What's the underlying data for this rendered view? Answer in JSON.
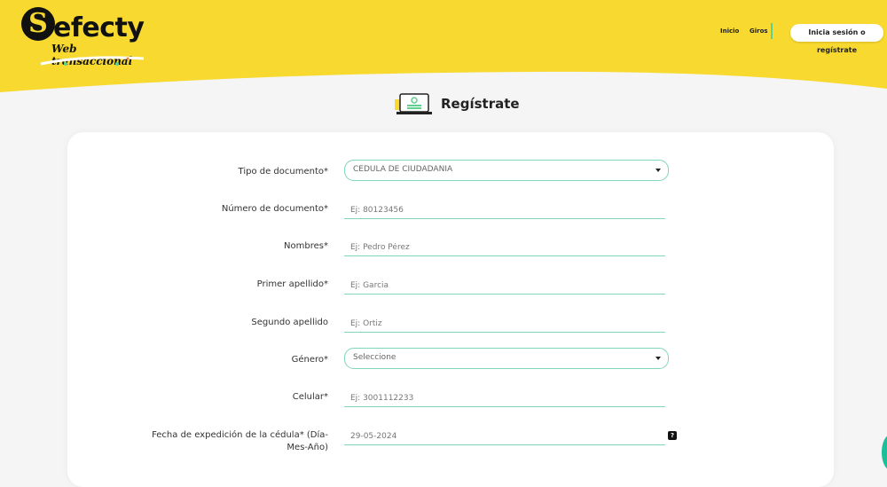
{
  "brand": {
    "logo_letter": "S",
    "logo_word": "efecty",
    "logo_subtitle": "Web transaccional"
  },
  "nav": {
    "links": [
      "Inicio",
      "Giros"
    ],
    "login_label": "Inicia sesión o regístrate"
  },
  "page": {
    "title": "Regístrate"
  },
  "form": {
    "tipo_documento": {
      "label": "Tipo de documento*",
      "value": "CEDULA DE CIUDADANIA"
    },
    "numero_documento": {
      "label": "Número de documento*",
      "placeholder": "Ej: 80123456"
    },
    "nombres": {
      "label": "Nombres*",
      "placeholder": "Ej: Pedro Pérez"
    },
    "primer_apellido": {
      "label": "Primer apellido*",
      "placeholder": "Ej: Garcia"
    },
    "segundo_apellido": {
      "label": "Segundo apellido",
      "placeholder": "Ej: Ortiz"
    },
    "genero": {
      "label": "Género*",
      "value": "Seleccione"
    },
    "celular": {
      "label": "Celular*",
      "placeholder": "Ej: 3001112233"
    },
    "fecha_expedicion": {
      "label_line1": "Fecha de expedición de la cédula* (Día-",
      "label_line2": "Mes-Año)",
      "placeholder": "29-05-2024",
      "help": "?"
    }
  },
  "colors": {
    "brand_yellow": "#f7d930",
    "accent_green": "#7fd6b8",
    "background": "#f5f5f5"
  },
  "icons": [
    "laptop-register-icon",
    "chevron-down-icon",
    "help-icon",
    "chat-icon"
  ]
}
